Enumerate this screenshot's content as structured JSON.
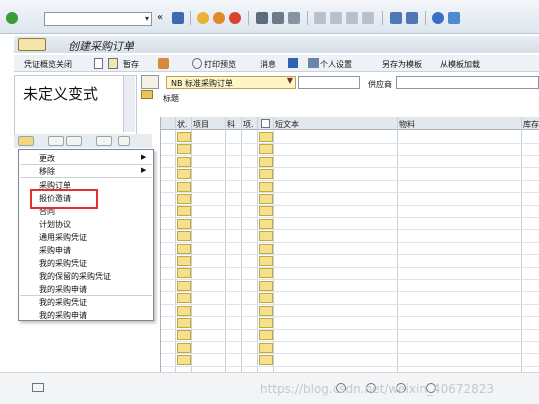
{
  "toolbar": {
    "back_symbol": "«",
    "command_value": ""
  },
  "window": {
    "title": "创建采购订单"
  },
  "app_toolbar": {
    "items": [
      "凭证概览关闭",
      "暂存",
      "打印预览",
      "消息",
      "个人设置",
      "另存为模板",
      "从模板加载"
    ]
  },
  "left_panel": {
    "heading": "未定义变式",
    "menu": {
      "items": [
        "更改",
        "移除",
        "采购订单",
        "报价邀请",
        "合同",
        "计划协议",
        "通用采购凭证",
        "采购申请",
        "我的采购凭证",
        "我的保留的采购凭证",
        "我的采购申请",
        "我的采购凭证",
        "我的采购申请"
      ],
      "submenu_arrow": "▶",
      "highlighted": "报价邀请"
    }
  },
  "header": {
    "doc_type_value": "NB 标准采购订单",
    "doc_number_value": "",
    "vendor_label": "供应商",
    "vendor_value": "",
    "section_label": "标题"
  },
  "table": {
    "columns": [
      "状.",
      "项目",
      "科",
      "项.",
      "短文本",
      "物料",
      "库存"
    ]
  },
  "footer": {
    "watermark": "https://blog.csdn.net/weixin_40672823"
  },
  "colors": {
    "accent_highlight": "#e23030",
    "input_yellow": "#fff6c8",
    "cell_yellow": "#f7e08a"
  }
}
